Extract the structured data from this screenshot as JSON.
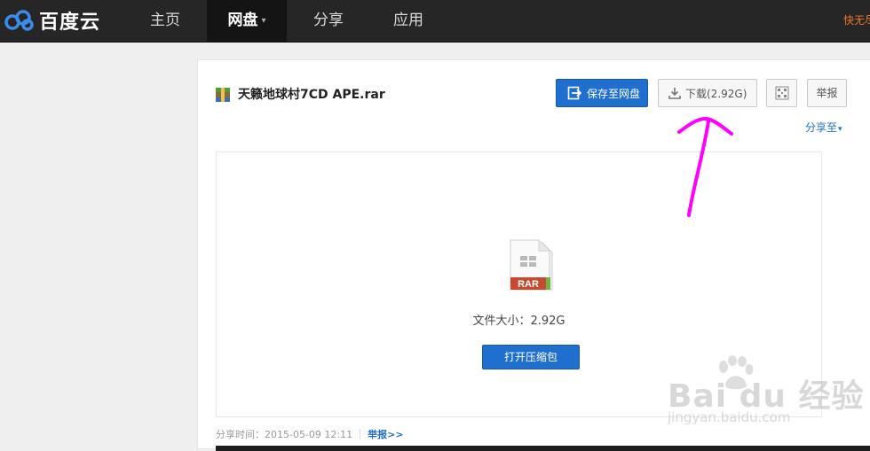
{
  "brand": {
    "logo_text": "百度云"
  },
  "nav": {
    "items": [
      {
        "label": "主页"
      },
      {
        "label": "网盘"
      },
      {
        "label": "分享"
      },
      {
        "label": "应用"
      }
    ],
    "promo_text": "快无尽"
  },
  "file": {
    "name": "天籁地球村7CD APE.rar",
    "size_label": "文件大小：2.92G",
    "type_badge": "RAR"
  },
  "actions": {
    "save_label": "保存至网盘",
    "download_label": "下载(2.92G)",
    "report_label": "举报",
    "share_to_label": "分享至",
    "open_archive_label": "打开压缩包"
  },
  "meta": {
    "share_time_label": "分享时间：",
    "share_time": "2015-05-09 12:11",
    "report_link": "举报>>"
  },
  "watermark": {
    "brand": "Bai du 经验",
    "url": "jingyan.baidu.com"
  },
  "colors": {
    "topbar": "#262626",
    "primary": "#1f6fce",
    "annotation": "#ff00ff",
    "rar_badge": "#c9492f"
  }
}
